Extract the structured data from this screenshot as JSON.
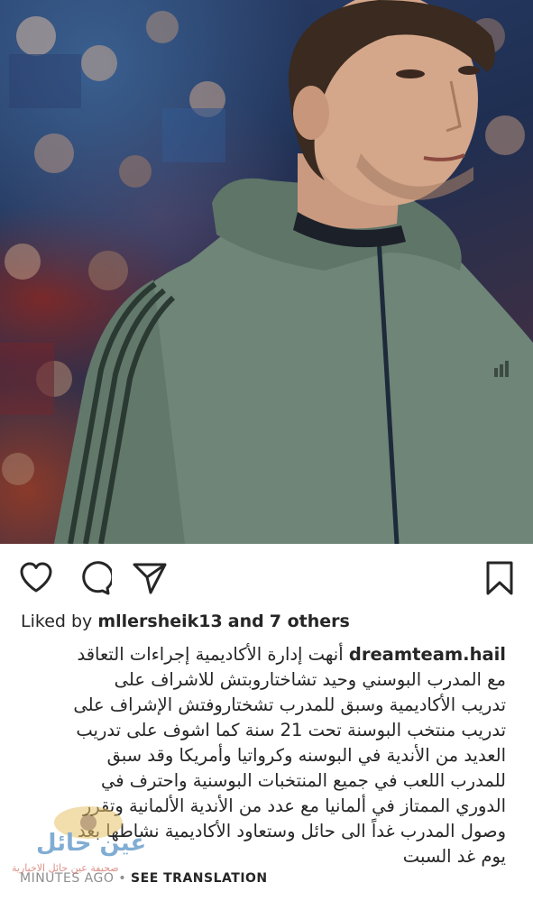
{
  "post": {
    "likes_prefix": "Liked by",
    "liked_by_user": "mllersheik13",
    "likes_and": "and",
    "likes_others": "7 others",
    "username": "dreamteam.hail",
    "caption_first": "أنهت إدارة الأكاديمية إجراءات التعاقد",
    "caption_lines": [
      "مع المدرب البوسني وحيد تشاختاروبتش للاشراف على",
      "تدريب الأكاديمية وسبق للمدرب تشختاروفتش الإشراف على",
      "تدريب منتخب البوسنة تحت 21 سنة كما اشوف على تدريب",
      "العديد من الأندية في البوسنه وكرواتيا وأمريكا وقد سبق",
      "للمدرب اللعب في جميع المنتخبات البوسنية واحترف في",
      "الدوري الممتاز في ألمانيا مع عدد من الأندية الألمانية وتقرر",
      "وصول المدرب غداً الى حائل وستعاود الأكاديمية نشاطها بعد",
      "يوم غد السبت"
    ],
    "timestamp": "MINUTES AGO",
    "separator": "•",
    "see_translation": "SEE TRANSLATION"
  },
  "icons": {
    "like": "heart-icon",
    "comment": "comment-icon",
    "share": "send-icon",
    "save": "bookmark-icon"
  },
  "watermark": {
    "title": "عين حائل",
    "subtitle": "صحيفة عين حائل الاخبارية"
  },
  "colors": {
    "text": "#262626",
    "muted": "#8e8e8e",
    "jacket": "#6e8578",
    "watermark_blue": "#1a6bb0",
    "watermark_red": "#c0392b"
  }
}
